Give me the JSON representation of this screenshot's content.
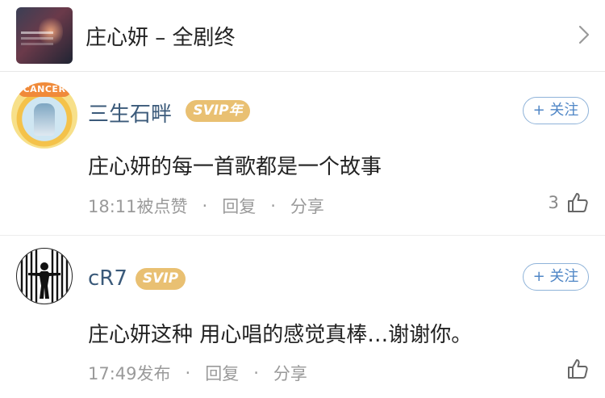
{
  "song": {
    "title": "庄心妍 – 全剧终",
    "cover_icon": "album-cover"
  },
  "comments": [
    {
      "avatar_badge": "CANCER",
      "username": "三生石畔",
      "vip_badge": "SVIP年",
      "follow_label": "+ 关注",
      "text": "庄心妍的每一首歌都是一个故事",
      "time": "18:11被点赞",
      "dot1": "·",
      "reply_label": "回复",
      "dot2": "·",
      "share_label": "分享",
      "likes": "3"
    },
    {
      "username": "cR7",
      "vip_badge": "SVIP",
      "follow_label": "+ 关注",
      "text": "庄心妍这种 用心唱的感觉真棒…谢谢你。",
      "time": "17:49发布",
      "dot1": "·",
      "reply_label": "回复",
      "dot2": "·",
      "share_label": "分享",
      "likes": ""
    }
  ],
  "colors": {
    "username": "#3b5a7a",
    "vip_gold": "#e9c072",
    "follow_blue": "#4f86c6",
    "meta_gray": "#9a9a9a"
  }
}
